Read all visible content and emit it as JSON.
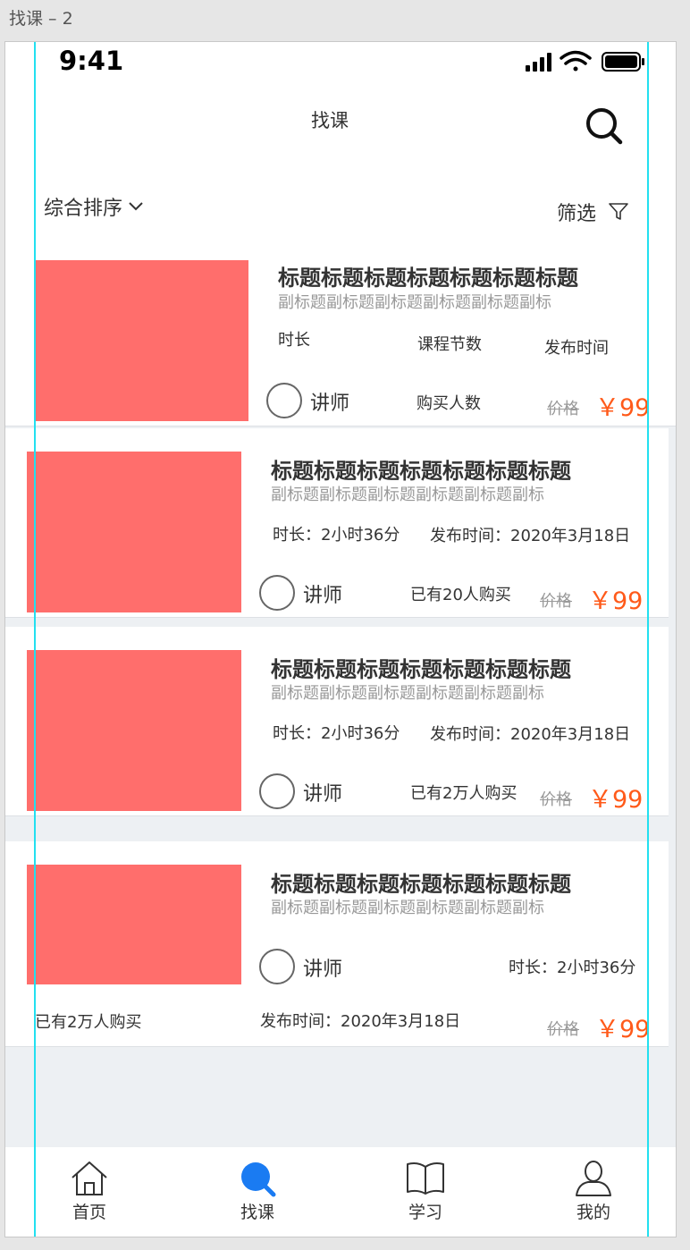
{
  "artboard": {
    "title": "找课 – 2"
  },
  "status_bar": {
    "time": "9:41",
    "icons": [
      "signal-icon",
      "wifi-icon",
      "battery-icon"
    ]
  },
  "nav": {
    "title": "找课",
    "search_icon": "search-icon"
  },
  "toolbar": {
    "sort_label": "综合排序",
    "sort_icon": "chevron-down-icon",
    "filter_label": "筛选",
    "filter_icon": "filter-icon"
  },
  "courses": [
    {
      "title": "标题标题标题标题标题标题标题",
      "subtitle": "副标题副标题副标题副标题副标题副标",
      "duration": "时长",
      "lessons": "课程节数",
      "publish": "发布时间",
      "teacher": "讲师",
      "buyers": "购买人数",
      "old_price": "价格",
      "price": "￥99"
    },
    {
      "title": "标题标题标题标题标题标题标题",
      "subtitle": "副标题副标题副标题副标题副标题副标",
      "duration": "时长：2小时36分",
      "publish": "发布时间：2020年3月18日",
      "teacher": "讲师",
      "buyers": "已有20人购买",
      "old_price": "价格",
      "price": "￥99"
    },
    {
      "title": "标题标题标题标题标题标题标题",
      "subtitle": "副标题副标题副标题副标题副标题副标",
      "duration": "时长：2小时36分",
      "publish": "发布时间：2020年3月18日",
      "teacher": "讲师",
      "buyers": "已有2万人购买",
      "old_price": "价格",
      "price": "￥99"
    },
    {
      "title": "标题标题标题标题标题标题标题",
      "subtitle": "副标题副标题副标题副标题副标题副标",
      "teacher": "讲师",
      "duration": "时长：2小时36分",
      "buyers": "已有2万人购买",
      "publish": "发布时间：2020年3月18日",
      "old_price": "价格",
      "price": "￥99"
    }
  ],
  "tabbar": {
    "active_color": "#1a7bf2",
    "tabs": [
      {
        "label": "首页",
        "icon": "home-icon"
      },
      {
        "label": "找课",
        "icon": "search-icon",
        "active": true
      },
      {
        "label": "学习",
        "icon": "book-icon"
      },
      {
        "label": "我的",
        "icon": "user-icon"
      }
    ]
  },
  "colors": {
    "thumbnail": "#ff6e6c",
    "price": "#ff5a1a",
    "guide": "#22e0f0"
  }
}
